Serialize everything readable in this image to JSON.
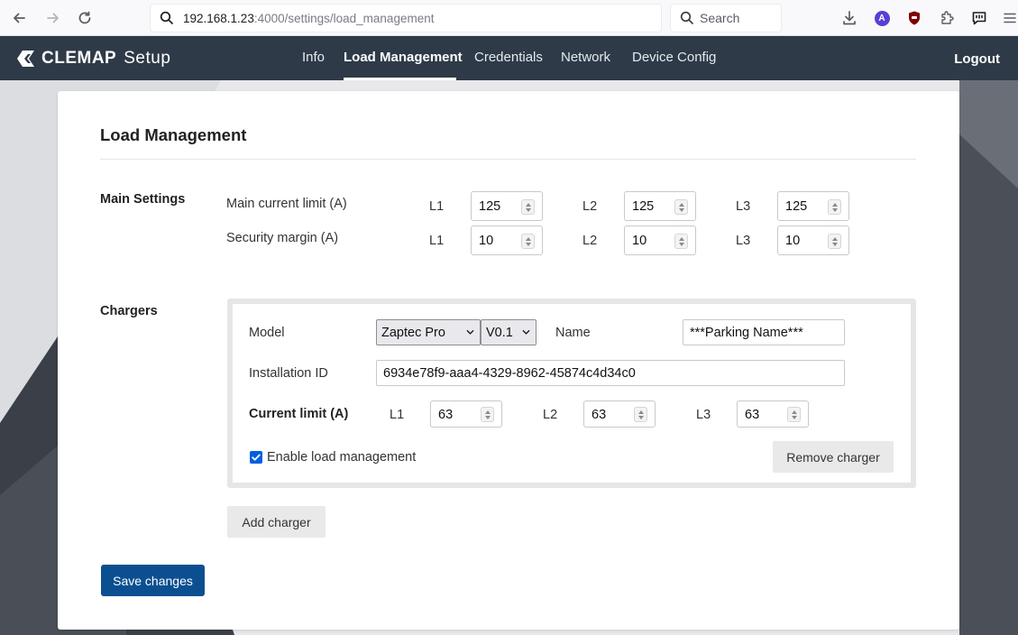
{
  "browser": {
    "url_host": "192.168.1.23",
    "url_path": ":4000/settings/load_management",
    "search_placeholder": "Search",
    "account_initial": "A"
  },
  "app": {
    "brand_name": "CLEMAP",
    "brand_suffix": "Setup",
    "nav": [
      {
        "label": "Info",
        "active": false
      },
      {
        "label": "Load Management",
        "active": true
      },
      {
        "label": "Credentials",
        "active": false
      },
      {
        "label": "Network",
        "active": false
      },
      {
        "label": "Device Config",
        "active": false
      }
    ],
    "logout_label": "Logout"
  },
  "page": {
    "title": "Load Management",
    "main_settings": {
      "section_label": "Main Settings",
      "main_current_limit": {
        "label": "Main current limit (A)",
        "phases": [
          {
            "phase": "L1",
            "value": "125"
          },
          {
            "phase": "L2",
            "value": "125"
          },
          {
            "phase": "L3",
            "value": "125"
          }
        ]
      },
      "security_margin": {
        "label": "Security margin (A)",
        "phases": [
          {
            "phase": "L1",
            "value": "10"
          },
          {
            "phase": "L2",
            "value": "10"
          },
          {
            "phase": "L3",
            "value": "10"
          }
        ]
      }
    },
    "chargers": {
      "section_label": "Chargers",
      "items": [
        {
          "model_label": "Model",
          "model_value": "Zaptec Pro",
          "version_value": "V0.1",
          "name_label": "Name",
          "name_value": "***Parking Name***",
          "installation_id_label": "Installation ID",
          "installation_id_value": "6934e78f9-aaa4-4329-8962-45874c4d34c0",
          "current_limit_label": "Current limit (A)",
          "current_limit": [
            {
              "phase": "L1",
              "value": "63"
            },
            {
              "phase": "L2",
              "value": "63"
            },
            {
              "phase": "L3",
              "value": "63"
            }
          ],
          "enable_label": "Enable load management",
          "enable_checked": true,
          "remove_label": "Remove charger"
        }
      ],
      "add_label": "Add charger"
    },
    "save_label": "Save changes"
  },
  "colors": {
    "appbar": "#2e3a48",
    "primary_button": "#0b4f91",
    "checkbox": "#0060df"
  }
}
